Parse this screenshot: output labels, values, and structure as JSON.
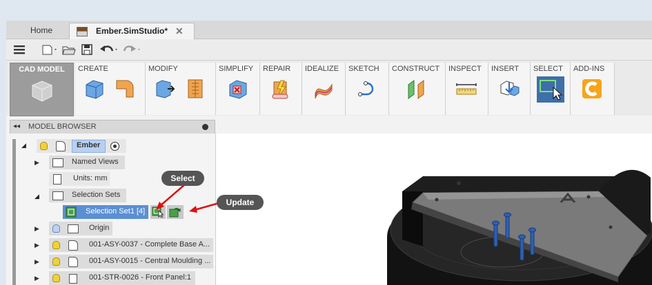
{
  "tabs": [
    {
      "label": "Home"
    },
    {
      "label": "Ember.SimStudio*"
    }
  ],
  "toolbar": {
    "icons": [
      "menu-icon",
      "new-icon",
      "open-icon",
      "save-icon",
      "undo-icon",
      "redo-icon"
    ]
  },
  "ribbon": {
    "workspace": "CAD MODEL",
    "groups": [
      "CREATE",
      "MODIFY",
      "SIMPLIFY",
      "REPAIR",
      "IDEALIZE",
      "SKETCH",
      "CONSTRUCT",
      "INSPECT",
      "INSERT",
      "SELECT",
      "ADD-INS"
    ]
  },
  "model_browser": {
    "title": "MODEL BROWSER",
    "root": "Ember",
    "items": [
      {
        "label": "Named Views"
      },
      {
        "label": "Units: mm"
      },
      {
        "label": "Selection Sets"
      },
      {
        "label": "Selection Set1 [4]"
      },
      {
        "label": "Origin"
      },
      {
        "label": "001-ASY-0037 - Complete Base A..."
      },
      {
        "label": "001-ASY-0015 - Central Moulding ..."
      },
      {
        "label": "001-STR-0026 - Front Panel:1"
      }
    ]
  },
  "callouts": {
    "select": "Select",
    "update": "Update"
  },
  "colors": {
    "selection_highlight": "#5b8fd4",
    "callout_bg": "#555555",
    "arrow": "#e01010",
    "ribbon_active": "#3f6fa8"
  }
}
